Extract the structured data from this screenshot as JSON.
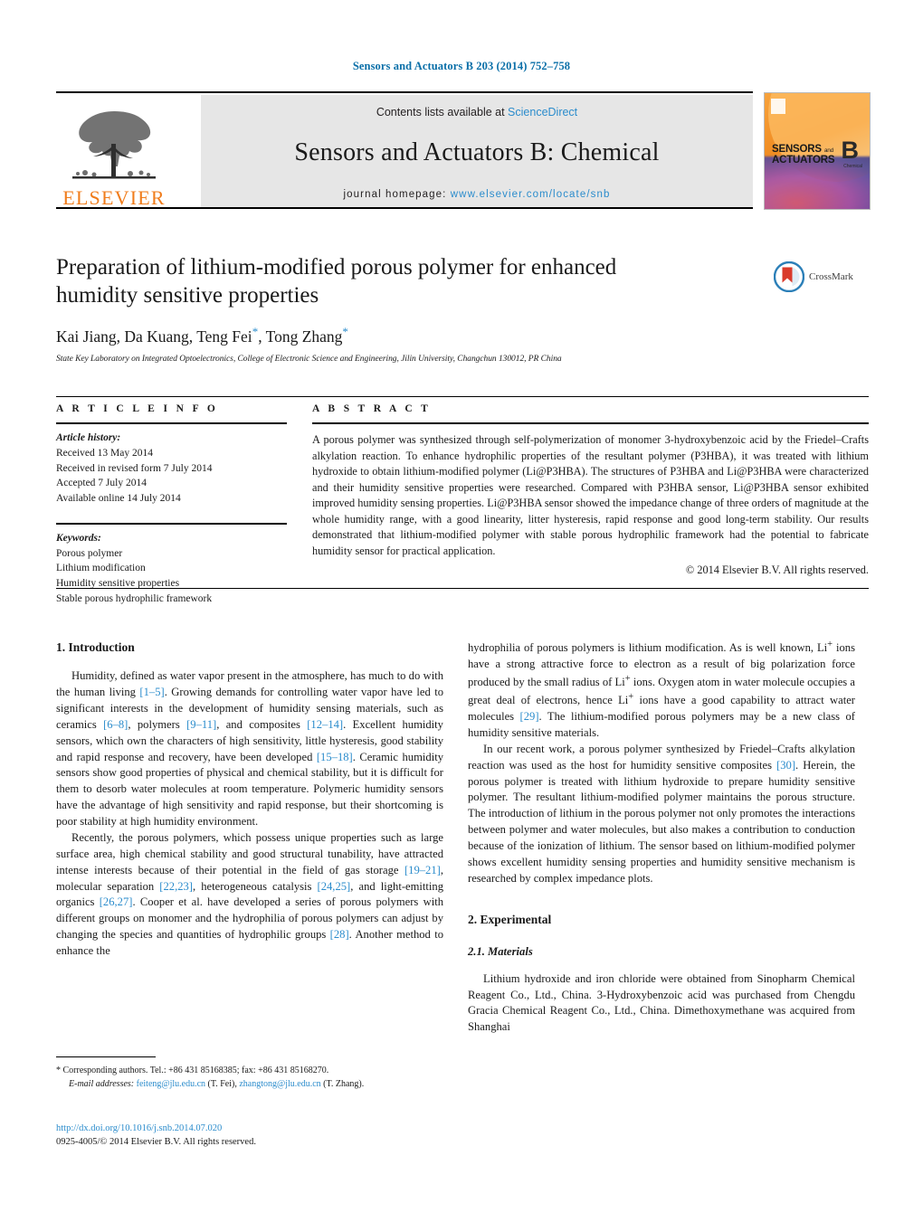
{
  "running_head": "Sensors and Actuators B 203 (2014) 752–758",
  "masthead": {
    "contents_prefix": "Contents lists available at ",
    "sciencedirect": "ScienceDirect",
    "journal_title": "Sensors and Actuators B: Chemical",
    "homepage_prefix": "journal homepage: ",
    "homepage_url": "www.elsevier.com/locate/snb",
    "publisher": "ELSEVIER",
    "cover": {
      "line1": "SENSORS",
      "and": "and",
      "line2": "ACTUATORS",
      "letter": "B",
      "letter_sub": "Chemical"
    },
    "colors": {
      "link": "#2b8ccc",
      "elsevier_orange": "#f07c1b",
      "band_grey": "#e6e6e6"
    }
  },
  "article": {
    "title": "Preparation of lithium-modified porous polymer for enhanced humidity sensitive properties",
    "authors": "Kai Jiang, Da Kuang, Teng Fei",
    "authors_tail": ", Tong Zhang",
    "affiliation": "State Key Laboratory on Integrated Optoelectronics, College of Electronic Science and Engineering, Jilin University, Changchun 130012, PR China",
    "crossmark_label": "CrossMark"
  },
  "info": {
    "heading": "A R T I C L E   I N F O",
    "history_heading": "Article history:",
    "history": [
      "Received 13 May 2014",
      "Received in revised form 7 July 2014",
      "Accepted 7 July 2014",
      "Available online 14 July 2014"
    ],
    "keywords_heading": "Keywords:",
    "keywords": [
      "Porous polymer",
      "Lithium modification",
      "Humidity sensitive properties",
      "Stable porous hydrophilic framework"
    ]
  },
  "abstract": {
    "heading": "A B S T R A C T",
    "text": "A porous polymer was synthesized through self-polymerization of monomer 3-hydroxybenzoic acid by the Friedel–Crafts alkylation reaction. To enhance hydrophilic properties of the resultant polymer (P3HBA), it was treated with lithium hydroxide to obtain lithium-modified polymer (Li@P3HBA). The structures of P3HBA and Li@P3HBA were characterized and their humidity sensitive properties were researched. Compared with P3HBA sensor, Li@P3HBA sensor exhibited improved humidity sensing properties. Li@P3HBA sensor showed the impedance change of three orders of magnitude at the whole humidity range, with a good linearity, litter hysteresis, rapid response and good long-term stability. Our results demonstrated that lithium-modified polymer with stable porous hydrophilic framework had the potential to fabricate humidity sensor for practical application.",
    "copyright": "© 2014 Elsevier B.V. All rights reserved."
  },
  "body": {
    "section1_heading": "1.  Introduction",
    "left_p1_a": "Humidity, defined as water vapor present in the atmosphere, has much to do with the human living ",
    "left_p1_r1": "[1–5]",
    "left_p1_b": ". Growing demands for controlling water vapor have led to significant interests in the development of humidity sensing materials, such as ceramics ",
    "left_p1_r2": "[6–8]",
    "left_p1_c": ", polymers ",
    "left_p1_r3": "[9–11]",
    "left_p1_d": ", and composites ",
    "left_p1_r4": "[12–14]",
    "left_p1_e": ". Excellent humidity sensors, which own the characters of high sensitivity, little hysteresis, good stability and rapid response and recovery, have been developed ",
    "left_p1_r5": "[15–18]",
    "left_p1_f": ". Ceramic humidity sensors show good properties of physical and chemical stability, but it is difficult for them to desorb water molecules at room temperature. Polymeric humidity sensors have the advantage of high sensitivity and rapid response, but their shortcoming is poor stability at high humidity environment.",
    "left_p2_a": "Recently, the porous polymers, which possess unique properties such as large surface area, high chemical stability and good structural tunability, have attracted intense interests because of their potential in the field of gas storage ",
    "left_p2_r1": "[19–21]",
    "left_p2_b": ", molecular separation ",
    "left_p2_r2": "[22,23]",
    "left_p2_c": ", heterogeneous catalysis ",
    "left_p2_r3": "[24,25]",
    "left_p2_d": ", and light-emitting organics ",
    "left_p2_r4": "[26,27]",
    "left_p2_e": ". Cooper et al. have developed a series of porous polymers with different groups on monomer and the hydrophilia of porous polymers can adjust by changing the species and quantities of hydrophilic groups ",
    "left_p2_r5": "[28]",
    "left_p2_f": ". Another method to enhance the",
    "right_p1_a": "hydrophilia of porous polymers is lithium modification. As is well known, Li",
    "right_p1_sup1": "+",
    "right_p1_b": " ions have a strong attractive force to electron as a result of big polarization force produced by the small radius of Li",
    "right_p1_sup2": "+",
    "right_p1_c": " ions. Oxygen atom in water molecule occupies a great deal of electrons, hence Li",
    "right_p1_sup3": "+",
    "right_p1_d": " ions have a good capability to attract water molecules ",
    "right_p1_r1": "[29]",
    "right_p1_e": ". The lithium-modified porous polymers may be a new class of humidity sensitive materials.",
    "right_p2_a": "In our recent work, a porous polymer synthesized by Friedel–Crafts alkylation reaction was used as the host for humidity sensitive composites ",
    "right_p2_r1": "[30]",
    "right_p2_b": ". Herein, the porous polymer is treated with lithium hydroxide to prepare humidity sensitive polymer. The resultant lithium-modified polymer maintains the porous structure. The introduction of lithium in the porous polymer not only promotes the interactions between polymer and water molecules, but also makes a contribution to conduction because of the ionization of lithium. The sensor based on lithium-modified polymer shows excellent humidity sensing properties and humidity sensitive mechanism is researched by complex impedance plots.",
    "section2_heading": "2.  Experimental",
    "section21_heading": "2.1.  Materials",
    "right_p3": "Lithium hydroxide and iron chloride were obtained from Sinopharm Chemical Reagent Co., Ltd., China. 3-Hydroxybenzoic acid was purchased from Chengdu Gracia Chemical Reagent Co., Ltd., China. Dimethoxymethane was acquired from Shanghai"
  },
  "footnote": {
    "star": "*",
    "corresponding": " Corresponding authors. Tel.: +86 431 85168385; fax: +86 431 85168270.",
    "email_label": "E-mail addresses:",
    "email1": "feiteng@jlu.edu.cn",
    "email1_who": " (T. Fei), ",
    "email2": "zhangtong@jlu.edu.cn",
    "email2_who": " (T. Zhang)."
  },
  "doi_block": {
    "doi": "http://dx.doi.org/10.1016/j.snb.2014.07.020",
    "issn": "0925-4005/© 2014 Elsevier B.V. All rights reserved."
  }
}
